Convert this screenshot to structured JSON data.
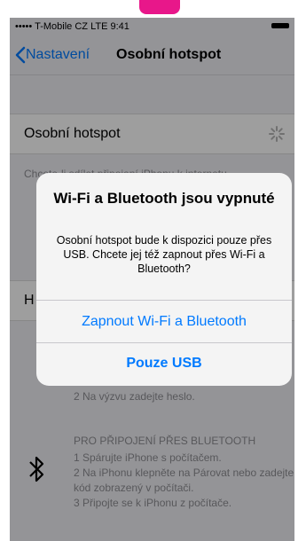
{
  "status": {
    "carrier": "••••• T-Mobile CZ  LTE  9:41"
  },
  "navbar": {
    "back_label": "Nastavení",
    "title": "Osobní hotspot"
  },
  "hotspot_cell": {
    "label": "Osobní hotspot"
  },
  "footer": {
    "text": "Chcete-li sdílet připojení iPhonu k internetu,"
  },
  "second_cell": {
    "label": "H"
  },
  "wifi_steps": {
    "step2": "2 Na výzvu zadejte heslo."
  },
  "bluetooth": {
    "title": "PRO PŘIPOJENÍ PŘES BLUETOOTH",
    "steps": [
      "1 Spárujte iPhone s počítačem.",
      "2 Na iPhonu klepněte na Párovat nebo zadejte kód zobrazený v počítači.",
      "3 Připojte se k iPhonu z počítače."
    ]
  },
  "alert": {
    "title": "Wi-Fi a Bluetooth jsou vypnuté",
    "message": "Osobní hotspot bude k dispozici pouze přes USB. Chcete jej též zapnout přes Wi-Fi a Bluetooth?",
    "primary_button": "Zapnout Wi-Fi a Bluetooth",
    "secondary_button": "Pouze USB"
  },
  "colors": {
    "accent": "#007aff",
    "pink": "#e8178a",
    "background": "#efeff4"
  },
  "icons": {
    "back": "chevron-left-icon",
    "spinner": "activity-spinner-icon",
    "bluetooth": "bluetooth-icon",
    "battery": "battery-icon"
  }
}
